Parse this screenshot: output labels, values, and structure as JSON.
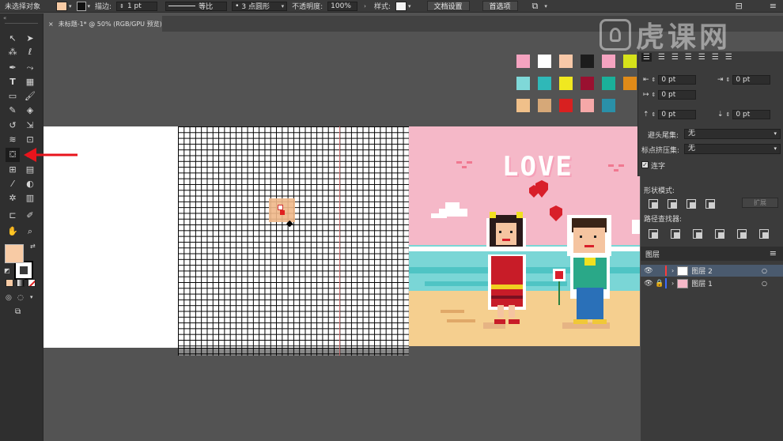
{
  "control_bar": {
    "selection_label": "未选择对象",
    "fill_color": "#f8cba5",
    "stroke_label": "描边:",
    "stroke_weight": "1 pt",
    "stroke_profile": "等比",
    "brush_label": "3 点圆形",
    "opacity_label": "不透明度:",
    "opacity_value": "100%",
    "style_label": "样式:",
    "doc_setup_button": "文档设置",
    "preferences_button": "首选项"
  },
  "document_tab": {
    "title": "未标题-1* @ 50% (RGB/GPU 预览)",
    "close_glyph": "×"
  },
  "tools": {
    "fill_swatch_color": "#f8cba5",
    "stroke_swatch_color": "#000000"
  },
  "swatches": [
    "#f5a3c0",
    "#ffffff",
    "#f8c8a8",
    "#1c1c1c",
    "#f5a3c0",
    "#d6e21a",
    "#7fd8d8",
    "#2fb8b8",
    "#f0e820",
    "#9a1030",
    "#1ab09a",
    "#e08a18",
    "#f0c08a",
    "#d6a878",
    "#d82020",
    "#f5a8a8",
    "#2a90a8"
  ],
  "illustration": {
    "love_text": "LOVE"
  },
  "paragraph_panel": {
    "indent_left": "0 pt",
    "indent_right": "0 pt",
    "indent_first": "0 pt",
    "space_before": "0 pt",
    "space_after": "0 pt",
    "kinsoku_label": "避头尾集:",
    "kinsoku_value": "无",
    "mojikumi_label": "标点挤压集:",
    "mojikumi_value": "无",
    "hyphenate_label": "连字"
  },
  "pathfinder_panel": {
    "shape_modes_label": "形状模式:",
    "expand_button": "扩展",
    "pathfinders_label": "路径查找器:"
  },
  "layers_panel": {
    "title": "图层",
    "layers": [
      {
        "name": "图层 2",
        "color": "#ff3b3b"
      },
      {
        "name": "图层 1",
        "color": "#3b6bff"
      }
    ]
  },
  "watermark": {
    "text": "虎课网"
  }
}
